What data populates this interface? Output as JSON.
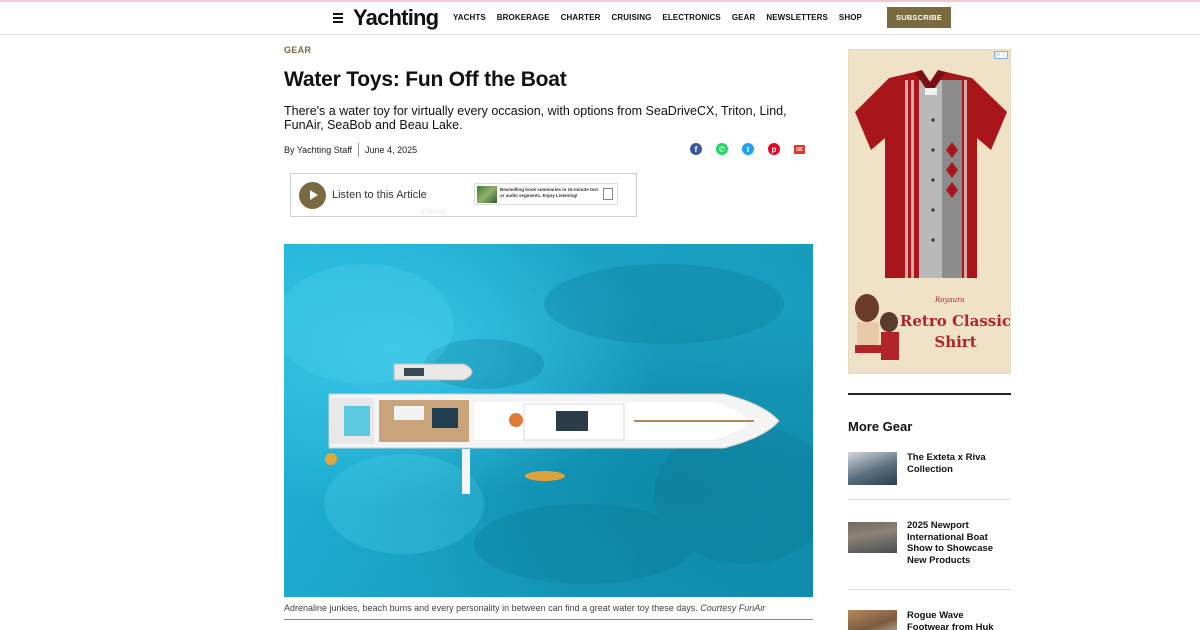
{
  "header": {
    "logo": "Yachting",
    "nav": [
      "YACHTS",
      "BROKERAGE",
      "CHARTER",
      "CRUISING",
      "ELECTRONICS",
      "GEAR",
      "NEWSLETTERS",
      "SHOP"
    ],
    "subscribe_label": "SUBSCRIBE"
  },
  "article": {
    "kicker": "GEAR",
    "title": "Water Toys: Fun Off the Boat",
    "dek": "There's a water toy for virtually every occasion, with options from SeaDriveCX, Triton, Lind, FunAir, SeaBob and Beau Lake.",
    "author": "By Yachting Staff",
    "date": "June 4, 2025",
    "share_icons": [
      "facebook-icon",
      "whatsapp-icon",
      "twitter-icon",
      "pinterest-icon",
      "email-icon"
    ],
    "caption_text": "Adrenaline junkies, beach bums and every personality in between can find a great water toy these days.",
    "caption_credit": "Courtesy FunAir"
  },
  "listen": {
    "label": "Listen to this Article",
    "ad_text": "Bestselling book summaries in 15-minute text or audio segments. Enjoy Listening!"
  },
  "sidebar_ad": {
    "brand": "Royaura",
    "line1": "Retro Classic",
    "line2": "Shirt"
  },
  "more_gear": {
    "title": "More Gear",
    "items": [
      {
        "label": "The Exteta x Riva Collection"
      },
      {
        "label": "2025 Newport International Boat Show to Showcase New Products"
      },
      {
        "label": "Rogue Wave Footwear from Huk"
      }
    ]
  },
  "colors": {
    "accent": "#7a6a3f",
    "facebook": "#3b5998",
    "whatsapp": "#25d366",
    "twitter": "#1da1f2",
    "pinterest": "#e60023",
    "email": "#d93a2b"
  }
}
